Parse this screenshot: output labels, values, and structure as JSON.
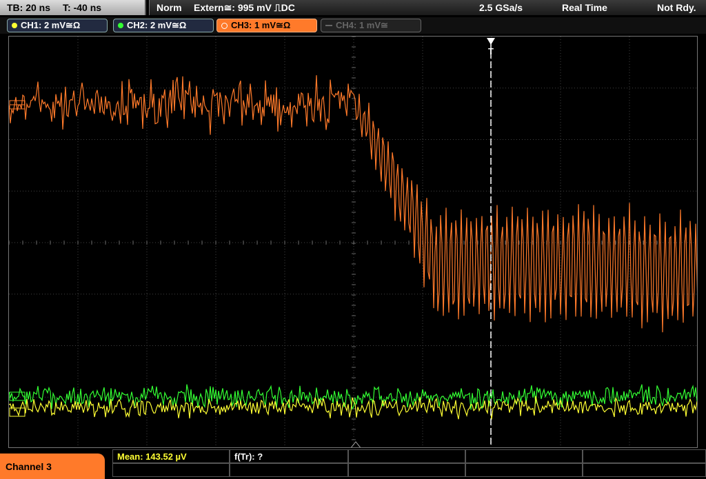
{
  "topbar": {
    "timebase": "TB: 20 ns",
    "trigger_time": "T: -40 ns",
    "mode": "Norm",
    "trigger_source": "Extern≅: 995 mV ⎍DC",
    "sample_rate": "2.5 GSa/s",
    "acq_mode": "Real Time",
    "status": "Not Rdy."
  },
  "channels": [
    {
      "label": "CH1: 2 mV≅Ω",
      "color": "#ffff33",
      "active": true
    },
    {
      "label": "CH2: 2 mV≅Ω",
      "color": "#33ff33",
      "active": true
    },
    {
      "label": "CH3: 1 mV≅Ω",
      "color": "#ff7a2a",
      "active": true,
      "selected": true
    },
    {
      "label": "CH4: 1 mV≅",
      "color": "#666666",
      "active": false
    }
  ],
  "trigger_marker": "T",
  "bottom": {
    "channel_label": "Channel 3",
    "mean": "Mean: 143.52 µV",
    "ftr": "f(Tr): ?"
  },
  "colors": {
    "ch1": "#ffff33",
    "ch2": "#33ff33",
    "ch3": "#ff7a2a",
    "grid": "#444444"
  }
}
